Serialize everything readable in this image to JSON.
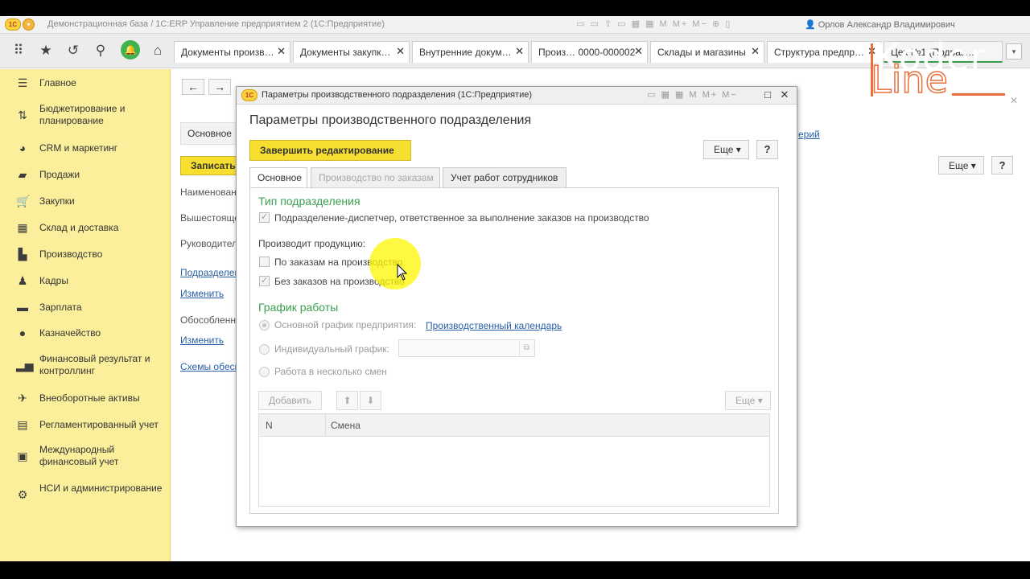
{
  "window": {
    "title": "Демонстрационная база / 1С:ERP Управление предприятием 2  (1С:Предприятие)",
    "logo_text": "1С",
    "user": "Орлов Александр Владимирович"
  },
  "tabs": [
    {
      "label": "Документы произв…"
    },
    {
      "label": "Документы закупк…"
    },
    {
      "label": "Внутренние докум…"
    },
    {
      "label": "Произ… 0000-000002"
    },
    {
      "label": "Склады и магазины"
    },
    {
      "label": "Структура предпр…"
    },
    {
      "label": "Цех №1 (Подраз…"
    }
  ],
  "sidebar": {
    "items": [
      {
        "label": "Главное",
        "icon": "menu-icon"
      },
      {
        "label": "Бюджетирование и планирование",
        "icon": "budget-icon"
      },
      {
        "label": "CRM и маркетинг",
        "icon": "crm-icon"
      },
      {
        "label": "Продажи",
        "icon": "sales-icon"
      },
      {
        "label": "Закупки",
        "icon": "cart-icon"
      },
      {
        "label": "Склад и доставка",
        "icon": "warehouse-icon"
      },
      {
        "label": "Производство",
        "icon": "production-icon"
      },
      {
        "label": "Кадры",
        "icon": "staff-icon"
      },
      {
        "label": "Зарплата",
        "icon": "salary-icon"
      },
      {
        "label": "Казначейство",
        "icon": "treasury-icon"
      },
      {
        "label": "Финансовый результат и контроллинг",
        "icon": "chart-icon"
      },
      {
        "label": "Внеоборотные активы",
        "icon": "assets-icon"
      },
      {
        "label": "Регламентированный учет",
        "icon": "accounting-icon"
      },
      {
        "label": "Международный финансовый учет",
        "icon": "intl-accounting-icon"
      },
      {
        "label": "НСИ и администрирование",
        "icon": "gear-icon"
      }
    ]
  },
  "bg_form": {
    "tab_main": "Основное",
    "save_button": "Записать",
    "labels": [
      "Наименование",
      "Вышестоящее",
      "Руководитель"
    ],
    "link_subdivision": "Подразделение",
    "link_change1": "Изменить",
    "label_separate": "Обособленное",
    "link_change2": "Изменить",
    "link_schemes": "Схемы обеспечения",
    "link_right": "ерий",
    "more_button": "Еще",
    "help_button": "?"
  },
  "modal": {
    "title": "Параметры производственного подразделения  (1С:Предприятие)",
    "heading": "Параметры производственного подразделения",
    "finish_button": "Завершить редактирование",
    "more_button": "Еще",
    "help_button": "?",
    "tabs": [
      {
        "label": "Основное"
      },
      {
        "label": "Производство по заказам"
      },
      {
        "label": "Учет работ сотрудников"
      }
    ],
    "type_group": {
      "title": "Тип подразделения",
      "dispatcher_checkbox": "Подразделение-диспетчер, ответственное за выполнение заказов на производство"
    },
    "produces": {
      "label": "Производит продукцию:",
      "by_orders": "По заказам на производство",
      "without_orders": "Без заказов на производство"
    },
    "schedule_group": {
      "title": "График работы",
      "option_main": "Основной график предприятия:",
      "calendar_link": "Производственный календарь",
      "option_individual": "Индивидуальный график:",
      "individual_value": "",
      "option_shifts": "Работа в несколько смен"
    },
    "table": {
      "add_button": "Добавить",
      "more_button": "Еще",
      "columns": [
        "N",
        "Смена"
      ]
    }
  },
  "watermark": {
    "line1": "Koder",
    "line2": "Line"
  },
  "colors": {
    "accent_green": "#3aa150",
    "button_yellow": "#f7df2f",
    "sidebar_bg": "#fbef9c",
    "link_blue": "#2960a6"
  }
}
